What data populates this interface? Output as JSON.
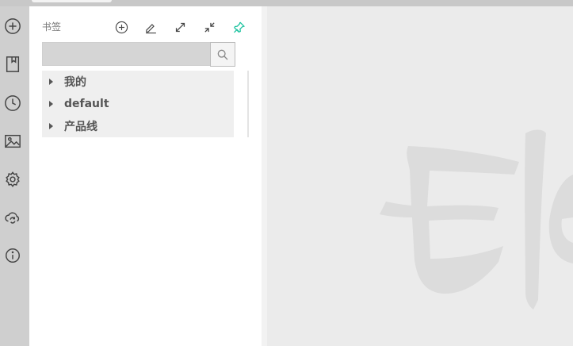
{
  "rail": {
    "items": [
      {
        "icon": "add-circle-icon"
      },
      {
        "icon": "bookmark-icon"
      },
      {
        "icon": "history-clock-icon"
      },
      {
        "icon": "image-icon"
      },
      {
        "icon": "settings-gear-icon"
      },
      {
        "icon": "cloud-sync-icon"
      },
      {
        "icon": "info-icon"
      }
    ]
  },
  "panel": {
    "title": "书签",
    "tools": [
      "add-icon",
      "edit-pencil-icon",
      "expand-icon",
      "collapse-icon",
      "pin-icon"
    ],
    "pin_color": "#1ec3a0",
    "search": {
      "value": "",
      "placeholder": ""
    },
    "tree": [
      {
        "label": "我的"
      },
      {
        "label": "default"
      },
      {
        "label": "产品线"
      }
    ]
  },
  "main": {
    "watermark_color": "#dcdcdc",
    "background": "#ebebeb"
  }
}
